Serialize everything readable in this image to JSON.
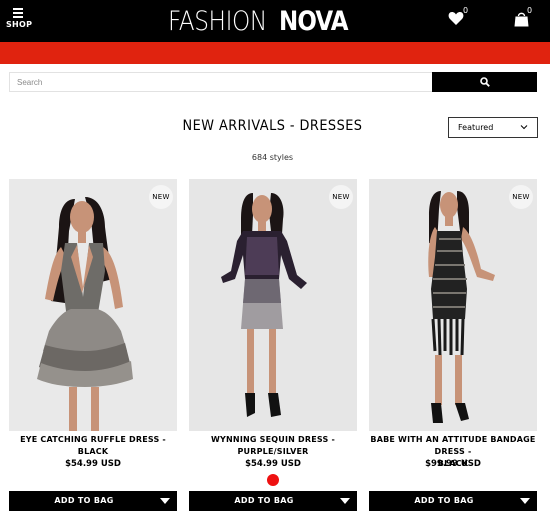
{
  "header": {
    "shop_label": "SHOP",
    "logo_light": "FASHION",
    "logo_bold": "NOVA",
    "wishlist_count": "0",
    "cart_count": "0"
  },
  "search": {
    "placeholder": "Search"
  },
  "page": {
    "title": "NEW ARRIVALS - DRESSES",
    "count": "684 styles",
    "sort_label": "Featured"
  },
  "colors": {
    "accent_red": "#e0230f",
    "black": "#000000",
    "swatch_red": "#ee1111"
  },
  "products": [
    {
      "badge": "NEW",
      "name": "EYE CATCHING RUFFLE DRESS - BLACK",
      "price": "$54.99 USD",
      "button": "ADD TO BAG"
    },
    {
      "badge": "NEW",
      "name": "WYNNING SEQUIN DRESS - PURPLE/SILVER",
      "price": "$54.99 USD",
      "button": "ADD TO BAG"
    },
    {
      "badge": "NEW",
      "name_line1": "BABE WITH AN ATTITUDE BANDAGE DRESS -",
      "name_line2": "BLACK",
      "price": "$99.99 USD",
      "button": "ADD TO BAG"
    }
  ]
}
